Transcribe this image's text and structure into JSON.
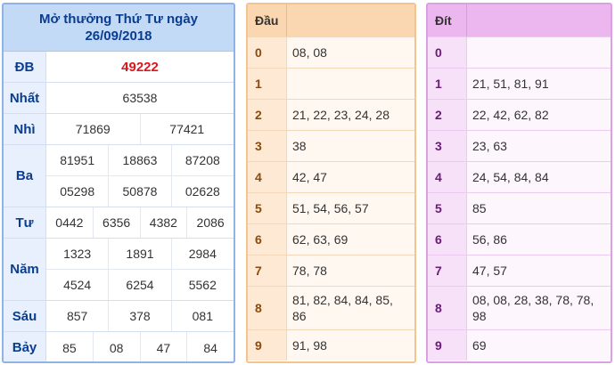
{
  "results": {
    "title_line1": "Mở thưởng Thứ Tư ngày",
    "title_line2": "26/09/2018",
    "rows": [
      {
        "label": "ĐB",
        "lines": [
          [
            "49222"
          ]
        ]
      },
      {
        "label": "Nhất",
        "lines": [
          [
            "63538"
          ]
        ]
      },
      {
        "label": "Nhì",
        "lines": [
          [
            "71869",
            "77421"
          ]
        ]
      },
      {
        "label": "Ba",
        "lines": [
          [
            "81951",
            "18863",
            "87208"
          ],
          [
            "05298",
            "50878",
            "02628"
          ]
        ]
      },
      {
        "label": "Tư",
        "lines": [
          [
            "0442",
            "6356",
            "4382",
            "2086"
          ]
        ]
      },
      {
        "label": "Năm",
        "lines": [
          [
            "1323",
            "1891",
            "2984"
          ],
          [
            "4524",
            "6254",
            "5562"
          ]
        ]
      },
      {
        "label": "Sáu",
        "lines": [
          [
            "857",
            "378",
            "081"
          ]
        ]
      },
      {
        "label": "Bảy",
        "lines": [
          [
            "85",
            "08",
            "47",
            "84"
          ]
        ]
      }
    ]
  },
  "dau": {
    "header": "Đầu",
    "rows": [
      {
        "k": "0",
        "v": "08, 08"
      },
      {
        "k": "1",
        "v": ""
      },
      {
        "k": "2",
        "v": "21, 22, 23, 24, 28"
      },
      {
        "k": "3",
        "v": "38"
      },
      {
        "k": "4",
        "v": "42, 47"
      },
      {
        "k": "5",
        "v": "51, 54, 56, 57"
      },
      {
        "k": "6",
        "v": "62, 63, 69"
      },
      {
        "k": "7",
        "v": "78, 78"
      },
      {
        "k": "8",
        "v": "81, 82, 84, 84, 85, 86"
      },
      {
        "k": "9",
        "v": "91, 98"
      }
    ]
  },
  "dit": {
    "header": "Đít",
    "rows": [
      {
        "k": "0",
        "v": ""
      },
      {
        "k": "1",
        "v": "21, 51, 81, 91"
      },
      {
        "k": "2",
        "v": "22, 42, 62, 82"
      },
      {
        "k": "3",
        "v": "23, 63"
      },
      {
        "k": "4",
        "v": "24, 54, 84, 84"
      },
      {
        "k": "5",
        "v": "85"
      },
      {
        "k": "6",
        "v": "56, 86"
      },
      {
        "k": "7",
        "v": "47, 57"
      },
      {
        "k": "8",
        "v": "08, 08, 28, 38, 78, 78, 98"
      },
      {
        "k": "9",
        "v": "69"
      }
    ]
  }
}
